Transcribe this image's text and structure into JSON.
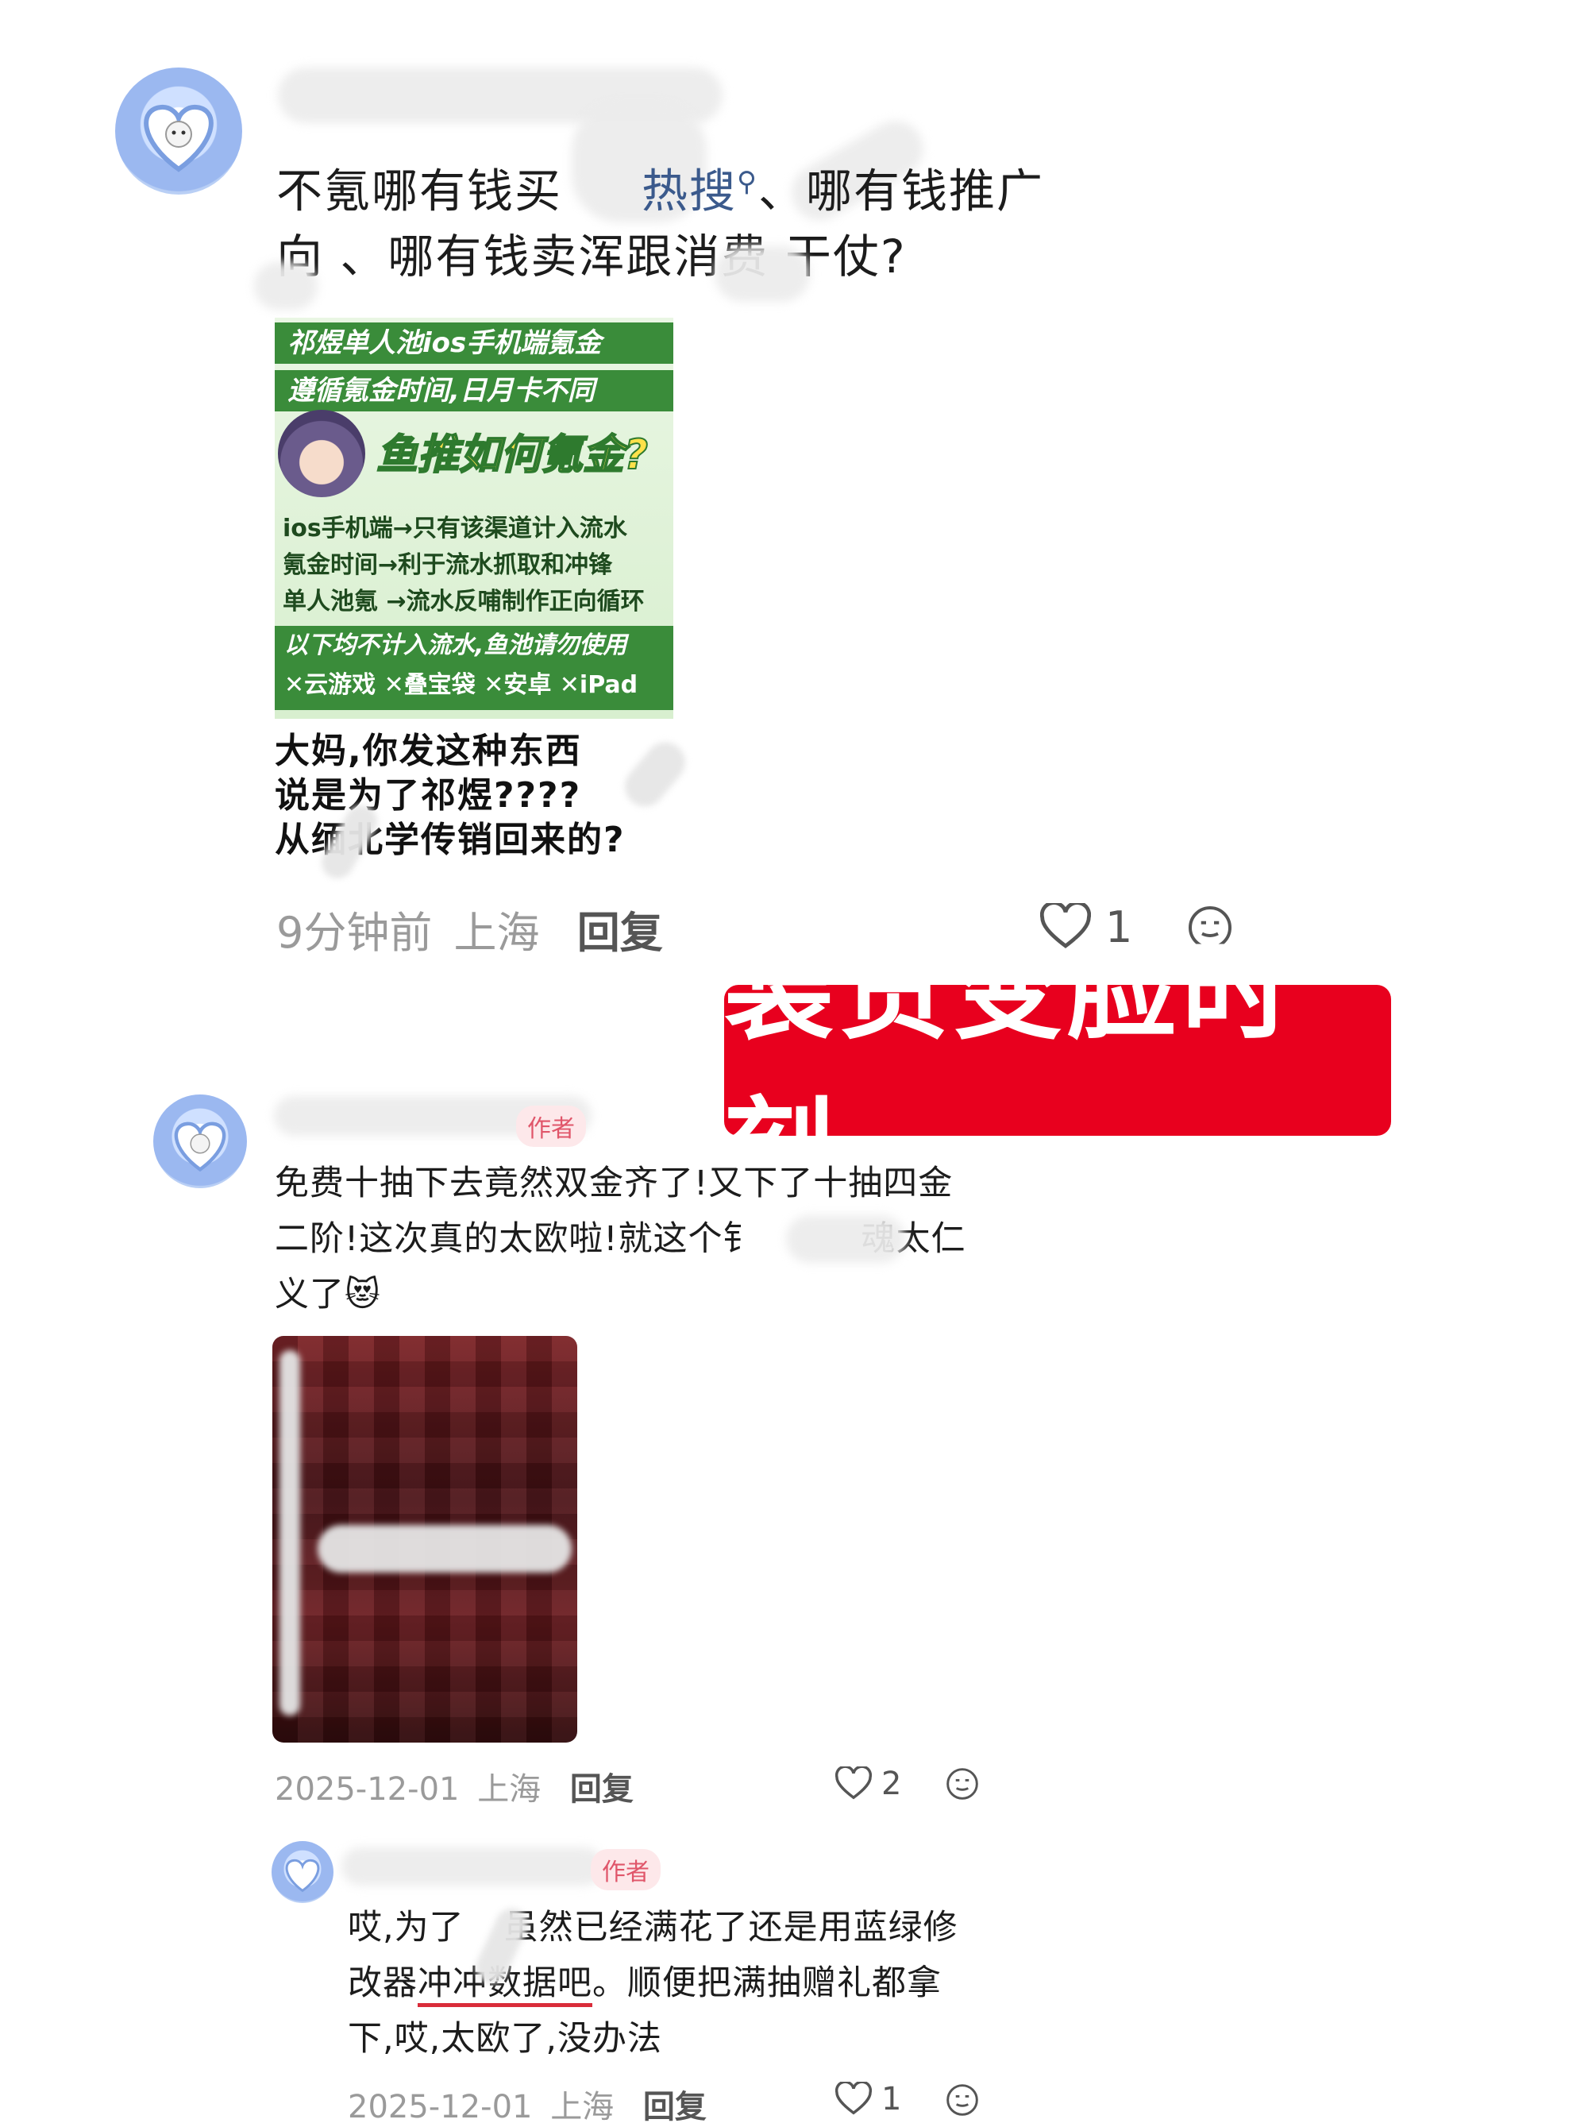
{
  "comment1": {
    "username": "",
    "text_line1_a": "不氪哪有钱买",
    "text_line1_link": "热搜",
    "text_line1_b": "、哪有钱推广",
    "text_line2": "向 、哪有钱卖浑跟消费 干仗?",
    "embedded_image": {
      "bar1": "祁煜单人池ios手机端氪金",
      "bar2": "遵循氪金时间,日月卡不同",
      "headline": "鱼推如何氪金?",
      "line1": "ios手机端→只有该渠道计入流水",
      "line2": "氪金时间→利于流水抓取和冲锋",
      "line3": "单人池氪 →流水反哺制作正向循环",
      "notice": "以下均不计入流水,鱼池请勿使用",
      "items": [
        "✕云游戏",
        "✕叠宝袋",
        "✕安卓",
        "✕iPad"
      ],
      "caption1": "大妈,你发这种东西",
      "caption2": "说是为了祁煜????",
      "caption3": "从缅北学传销回来的?"
    },
    "meta": {
      "time": "9分钟前",
      "location": "上海",
      "reply": "回复",
      "likes": "1"
    }
  },
  "banner": {
    "text": "装货变脸时刻",
    "color": "#e8001e"
  },
  "comment2": {
    "username": "",
    "badge": "作者",
    "text_line1": "免费十抽下去竟然双金齐了!又下了十抽四金",
    "text_line2": "二阶!这次真的太欧啦!就这个钅",
    "text_line2_b": "魂太仁",
    "text_line3": "义了",
    "emoji": "😻",
    "meta": {
      "date": "2025-12-01",
      "location": "上海",
      "reply": "回复",
      "likes": "2"
    }
  },
  "reply1": {
    "username": "",
    "badge": "作者",
    "text_line1": "哎,为了",
    "text_line1_b": "虽然已经满花了还是用蓝绿修",
    "text_line2_a": "改器",
    "text_line2_u": "冲冲数据吧",
    "text_line2_b": "。顺便把满抽赠礼都拿",
    "text_line3": "下,哎,太欧了,没办法",
    "meta": {
      "date": "2025-12-01",
      "location": "上海",
      "reply": "回复",
      "likes": "1"
    }
  },
  "colors": {
    "underline": "#d92c3a",
    "link": "#3b5a8c",
    "badge_bg": "#fde8ea",
    "badge_text": "#e0566a"
  }
}
